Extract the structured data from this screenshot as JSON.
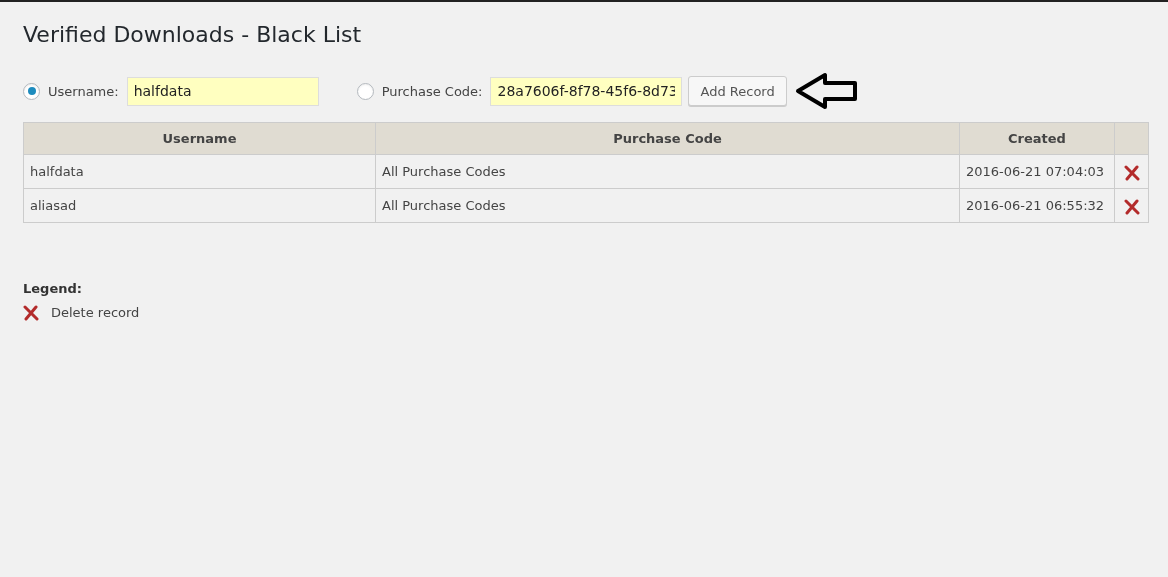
{
  "title": "Verified Downloads - Black List",
  "form": {
    "options": [
      {
        "label": "Username:",
        "selected": true,
        "value": "halfdata"
      },
      {
        "label": "Purchase Code:",
        "selected": false,
        "value": "28a7606f-8f78-45f6-8d73"
      }
    ],
    "button": "Add Record"
  },
  "table": {
    "columns": [
      "Username",
      "Purchase Code",
      "Created"
    ],
    "rows": [
      {
        "username": "halfdata",
        "purchase_code": "All Purchase Codes",
        "created": "2016-06-21 07:04:03"
      },
      {
        "username": "aliasad",
        "purchase_code": "All Purchase Codes",
        "created": "2016-06-21 06:55:32"
      }
    ]
  },
  "legend": {
    "title": "Legend:",
    "items": [
      {
        "label": "Delete record"
      }
    ]
  }
}
